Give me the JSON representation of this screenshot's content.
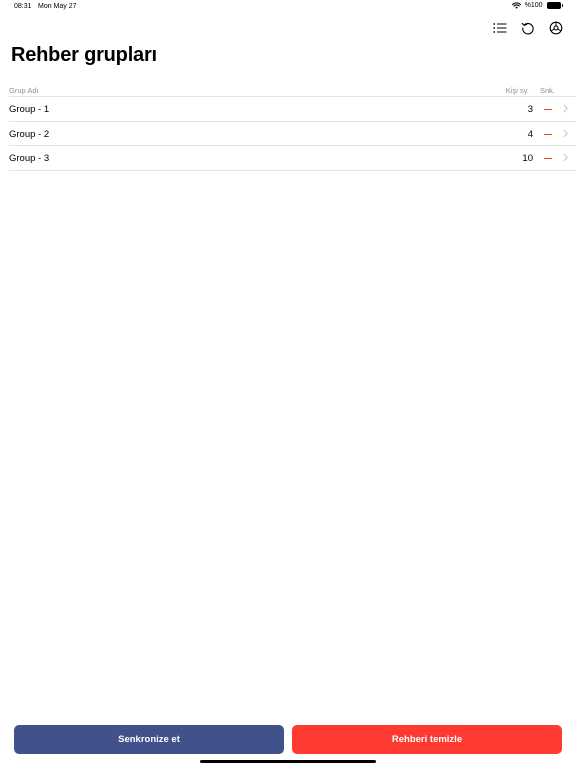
{
  "status_bar": {
    "time": "08:31",
    "date": "Mon May 27",
    "battery_text": "%100",
    "icons": [
      "wifi-icon",
      "battery-icon"
    ]
  },
  "toolbar": {
    "icons": [
      "list-icon",
      "refresh-icon",
      "settings-icon"
    ]
  },
  "title": "Rehber grupları",
  "table": {
    "headers": {
      "name": "Grup Adı",
      "count": "Kişi sy.",
      "sync": "Snk."
    },
    "rows": [
      {
        "name": "Group - 1",
        "count": "3"
      },
      {
        "name": "Group - 2",
        "count": "4"
      },
      {
        "name": "Group - 3",
        "count": "10"
      }
    ]
  },
  "buttons": {
    "sync": "Senkronize et",
    "clear": "Rehberi temizle"
  },
  "colors": {
    "sync_button": "#41518c",
    "clear_button": "#ff3a30",
    "sync_status": "#ff3b30"
  }
}
